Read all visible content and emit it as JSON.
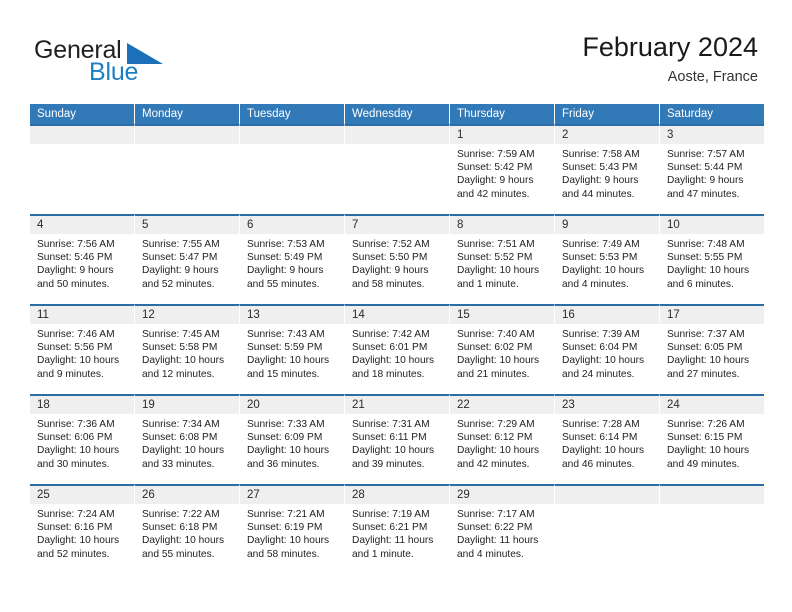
{
  "brand": {
    "name_top": "General",
    "name_bottom": "Blue",
    "accent_color": "#1b70b8",
    "text_color": "#231f20"
  },
  "header": {
    "title": "February 2024",
    "subtitle": "Aoste, France",
    "header_bg": "#3279b8",
    "row_divider_color": "#2e6da4",
    "day_number_bg": "#efefef"
  },
  "weekdays": [
    "Sunday",
    "Monday",
    "Tuesday",
    "Wednesday",
    "Thursday",
    "Friday",
    "Saturday"
  ],
  "weeks": [
    [
      {
        "day": "",
        "lines": []
      },
      {
        "day": "",
        "lines": []
      },
      {
        "day": "",
        "lines": []
      },
      {
        "day": "",
        "lines": []
      },
      {
        "day": "1",
        "lines": [
          "Sunrise: 7:59 AM",
          "Sunset: 5:42 PM",
          "Daylight: 9 hours",
          "and 42 minutes."
        ]
      },
      {
        "day": "2",
        "lines": [
          "Sunrise: 7:58 AM",
          "Sunset: 5:43 PM",
          "Daylight: 9 hours",
          "and 44 minutes."
        ]
      },
      {
        "day": "3",
        "lines": [
          "Sunrise: 7:57 AM",
          "Sunset: 5:44 PM",
          "Daylight: 9 hours",
          "and 47 minutes."
        ]
      }
    ],
    [
      {
        "day": "4",
        "lines": [
          "Sunrise: 7:56 AM",
          "Sunset: 5:46 PM",
          "Daylight: 9 hours",
          "and 50 minutes."
        ]
      },
      {
        "day": "5",
        "lines": [
          "Sunrise: 7:55 AM",
          "Sunset: 5:47 PM",
          "Daylight: 9 hours",
          "and 52 minutes."
        ]
      },
      {
        "day": "6",
        "lines": [
          "Sunrise: 7:53 AM",
          "Sunset: 5:49 PM",
          "Daylight: 9 hours",
          "and 55 minutes."
        ]
      },
      {
        "day": "7",
        "lines": [
          "Sunrise: 7:52 AM",
          "Sunset: 5:50 PM",
          "Daylight: 9 hours",
          "and 58 minutes."
        ]
      },
      {
        "day": "8",
        "lines": [
          "Sunrise: 7:51 AM",
          "Sunset: 5:52 PM",
          "Daylight: 10 hours",
          "and 1 minute."
        ]
      },
      {
        "day": "9",
        "lines": [
          "Sunrise: 7:49 AM",
          "Sunset: 5:53 PM",
          "Daylight: 10 hours",
          "and 4 minutes."
        ]
      },
      {
        "day": "10",
        "lines": [
          "Sunrise: 7:48 AM",
          "Sunset: 5:55 PM",
          "Daylight: 10 hours",
          "and 6 minutes."
        ]
      }
    ],
    [
      {
        "day": "11",
        "lines": [
          "Sunrise: 7:46 AM",
          "Sunset: 5:56 PM",
          "Daylight: 10 hours",
          "and 9 minutes."
        ]
      },
      {
        "day": "12",
        "lines": [
          "Sunrise: 7:45 AM",
          "Sunset: 5:58 PM",
          "Daylight: 10 hours",
          "and 12 minutes."
        ]
      },
      {
        "day": "13",
        "lines": [
          "Sunrise: 7:43 AM",
          "Sunset: 5:59 PM",
          "Daylight: 10 hours",
          "and 15 minutes."
        ]
      },
      {
        "day": "14",
        "lines": [
          "Sunrise: 7:42 AM",
          "Sunset: 6:01 PM",
          "Daylight: 10 hours",
          "and 18 minutes."
        ]
      },
      {
        "day": "15",
        "lines": [
          "Sunrise: 7:40 AM",
          "Sunset: 6:02 PM",
          "Daylight: 10 hours",
          "and 21 minutes."
        ]
      },
      {
        "day": "16",
        "lines": [
          "Sunrise: 7:39 AM",
          "Sunset: 6:04 PM",
          "Daylight: 10 hours",
          "and 24 minutes."
        ]
      },
      {
        "day": "17",
        "lines": [
          "Sunrise: 7:37 AM",
          "Sunset: 6:05 PM",
          "Daylight: 10 hours",
          "and 27 minutes."
        ]
      }
    ],
    [
      {
        "day": "18",
        "lines": [
          "Sunrise: 7:36 AM",
          "Sunset: 6:06 PM",
          "Daylight: 10 hours",
          "and 30 minutes."
        ]
      },
      {
        "day": "19",
        "lines": [
          "Sunrise: 7:34 AM",
          "Sunset: 6:08 PM",
          "Daylight: 10 hours",
          "and 33 minutes."
        ]
      },
      {
        "day": "20",
        "lines": [
          "Sunrise: 7:33 AM",
          "Sunset: 6:09 PM",
          "Daylight: 10 hours",
          "and 36 minutes."
        ]
      },
      {
        "day": "21",
        "lines": [
          "Sunrise: 7:31 AM",
          "Sunset: 6:11 PM",
          "Daylight: 10 hours",
          "and 39 minutes."
        ]
      },
      {
        "day": "22",
        "lines": [
          "Sunrise: 7:29 AM",
          "Sunset: 6:12 PM",
          "Daylight: 10 hours",
          "and 42 minutes."
        ]
      },
      {
        "day": "23",
        "lines": [
          "Sunrise: 7:28 AM",
          "Sunset: 6:14 PM",
          "Daylight: 10 hours",
          "and 46 minutes."
        ]
      },
      {
        "day": "24",
        "lines": [
          "Sunrise: 7:26 AM",
          "Sunset: 6:15 PM",
          "Daylight: 10 hours",
          "and 49 minutes."
        ]
      }
    ],
    [
      {
        "day": "25",
        "lines": [
          "Sunrise: 7:24 AM",
          "Sunset: 6:16 PM",
          "Daylight: 10 hours",
          "and 52 minutes."
        ]
      },
      {
        "day": "26",
        "lines": [
          "Sunrise: 7:22 AM",
          "Sunset: 6:18 PM",
          "Daylight: 10 hours",
          "and 55 minutes."
        ]
      },
      {
        "day": "27",
        "lines": [
          "Sunrise: 7:21 AM",
          "Sunset: 6:19 PM",
          "Daylight: 10 hours",
          "and 58 minutes."
        ]
      },
      {
        "day": "28",
        "lines": [
          "Sunrise: 7:19 AM",
          "Sunset: 6:21 PM",
          "Daylight: 11 hours",
          "and 1 minute."
        ]
      },
      {
        "day": "29",
        "lines": [
          "Sunrise: 7:17 AM",
          "Sunset: 6:22 PM",
          "Daylight: 11 hours",
          "and 4 minutes."
        ]
      },
      {
        "day": "",
        "lines": []
      },
      {
        "day": "",
        "lines": []
      }
    ]
  ]
}
